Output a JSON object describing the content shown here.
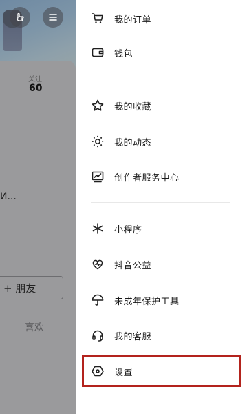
{
  "profile": {
    "follow_label": "关注",
    "follow_count": "60",
    "intro_fragment": "И...",
    "friend_button": "+ 朋友",
    "like_tab": "喜欢"
  },
  "drawer": {
    "items": [
      {
        "label": "我的订单",
        "icon": "shopping-cart-icon"
      },
      {
        "label": "钱包",
        "icon": "wallet-icon"
      },
      {
        "label": "我的收藏",
        "icon": "star-icon"
      },
      {
        "label": "我的动态",
        "icon": "activity-dots-icon"
      },
      {
        "label": "创作者服务中心",
        "icon": "creator-chart-icon"
      },
      {
        "label": "小程序",
        "icon": "mini-program-icon"
      },
      {
        "label": "抖音公益",
        "icon": "charity-heart-icon"
      },
      {
        "label": "未成年保护工具",
        "icon": "umbrella-icon"
      },
      {
        "label": "我的客服",
        "icon": "headset-icon"
      },
      {
        "label": "设置",
        "icon": "settings-hexagon-icon"
      }
    ],
    "highlight_color": "#b3231d"
  }
}
